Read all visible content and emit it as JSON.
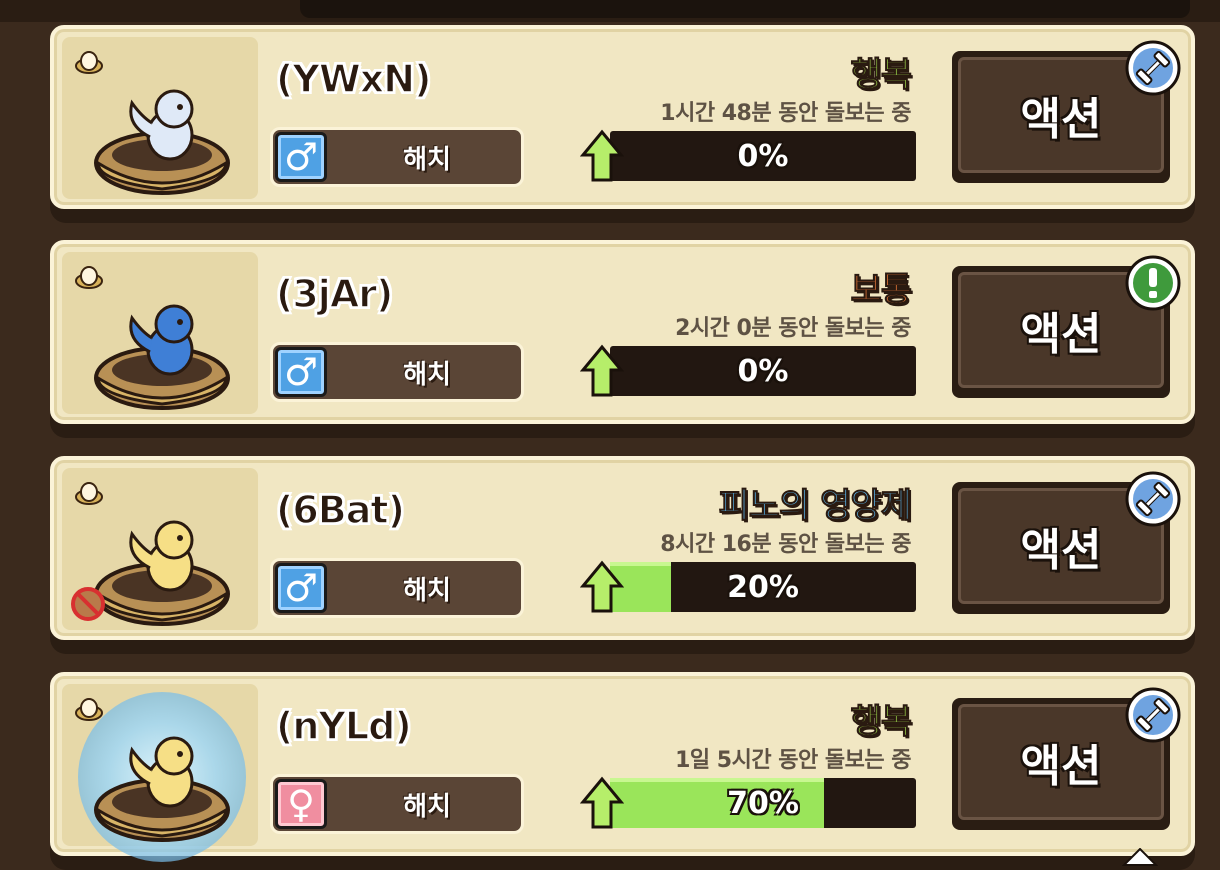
{
  "pets": [
    {
      "name": "(YWxN)",
      "gender": "male",
      "gender_symbol": "♂",
      "hatch_label": "해치",
      "mood": "행복",
      "mood_color": "#9bd24a",
      "care_time": "1시간 48분 동안 돌보는 중",
      "progress_text": "0%",
      "progress_value": 0,
      "action_label": "액션",
      "badge_icon": "dumbbell-icon",
      "pet_color": "#dfe9f7",
      "aura": false,
      "no_icon": false
    },
    {
      "name": "(3jAr)",
      "gender": "male",
      "gender_symbol": "♂",
      "hatch_label": "해치",
      "mood": "보통",
      "mood_color": "#f07c3a",
      "care_time": "2시간 0분 동안 돌보는 중",
      "progress_text": "0%",
      "progress_value": 0,
      "action_label": "액션",
      "badge_icon": "exclamation-icon",
      "pet_color": "#3f7fd6",
      "aura": false,
      "no_icon": false
    },
    {
      "name": "(6Bat)",
      "gender": "male",
      "gender_symbol": "♂",
      "hatch_label": "해치",
      "mood": "피노의 영양제",
      "mood_color": "#5ab8f0",
      "care_time": "8시간 16분 동안 돌보는 중",
      "progress_text": "20%",
      "progress_value": 20,
      "action_label": "액션",
      "badge_icon": "dumbbell-icon",
      "pet_color": "#f6df86",
      "aura": false,
      "no_icon": true
    },
    {
      "name": "(nYLd)",
      "gender": "female",
      "gender_symbol": "♀",
      "hatch_label": "해치",
      "mood": "행복",
      "mood_color": "#9bd24a",
      "care_time": "1일 5시간 동안 돌보는 중",
      "progress_text": "70%",
      "progress_value": 70,
      "action_label": "액션",
      "badge_icon": "dumbbell-icon",
      "pet_color": "#f6df86",
      "aura": true,
      "no_icon": false
    }
  ],
  "colors": {
    "background": "#3b2a1d",
    "card": "#f1e7c3",
    "progress_fill": "#9ae55a",
    "badge_blue": "#6fa3e0",
    "badge_green": "#3f9a3c"
  }
}
